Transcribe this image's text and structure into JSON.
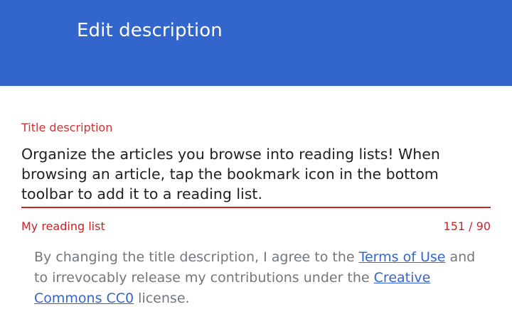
{
  "app_bar": {
    "title": "Edit description"
  },
  "form": {
    "label": "Title description",
    "value": "Organize the articles you browse into reading lists! When\nbrowsing an article, tap the bookmark icon in the bottom\ntoolbar to add it to a reading list.",
    "helper_text": "My reading list",
    "char_count": "151 / 90"
  },
  "license": {
    "prefix": "By changing the title description, I agree to the ",
    "terms_link": "Terms of Use",
    "middle": " and to irrevocably release my contributions under the ",
    "cc_link": "Creative Commons CC0",
    "suffix": " license."
  },
  "colors": {
    "app_bar": "#3366cc",
    "error": "#d33131",
    "link": "#3366cc",
    "muted_text": "#72777d"
  }
}
